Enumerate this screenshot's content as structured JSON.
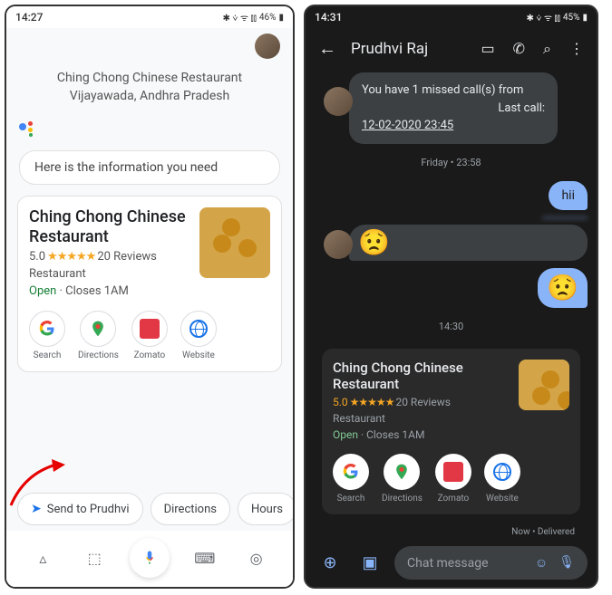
{
  "left": {
    "status": {
      "time": "14:27",
      "battery": "46%",
      "icons": "✱ ⩒ ᯤ ⫾⫾"
    },
    "location": {
      "line1": "Ching Chong Chinese Restaurant",
      "line2": "Vijayawada, Andhra Pradesh"
    },
    "assist_bubble": "Here is the information you need",
    "card": {
      "title": "Ching Chong Chinese Restaurant",
      "rating": "5.0",
      "stars": "★★★★★",
      "reviews": "20 Reviews",
      "category": "Restaurant",
      "open": "Open",
      "close": " · Closes 1AM",
      "actions": [
        {
          "label": "Search"
        },
        {
          "label": "Directions"
        },
        {
          "label": "Zomato"
        },
        {
          "label": "Website"
        }
      ]
    },
    "chips": [
      {
        "label": "Send to Prudhvi",
        "send": true
      },
      {
        "label": "Directions"
      },
      {
        "label": "Hours"
      }
    ]
  },
  "right": {
    "status": {
      "time": "14:31",
      "battery": "45%",
      "icons": "✱ ⩒ ᯤ ⫾⫾"
    },
    "header": {
      "title": "Prudhvi Raj"
    },
    "missed": {
      "line1": "You have 1 missed call(s) from",
      "line2": "Last call:",
      "date": "12-02-2020 23:45"
    },
    "date1": "Friday • 23:58",
    "msg_hii": "hii",
    "emoji": "😟",
    "time2": "14:30",
    "card": {
      "title": "Ching Chong Chinese Restaurant",
      "rating": "5.0",
      "stars": "★★★★★",
      "reviews": "20 Reviews",
      "category": "Restaurant",
      "open": "Open",
      "close": " · Closes 1AM",
      "actions": [
        {
          "label": "Search"
        },
        {
          "label": "Directions"
        },
        {
          "label": "Zomato"
        },
        {
          "label": "Website"
        }
      ]
    },
    "delivery": "Now • Delivered",
    "compose_placeholder": "Chat message"
  }
}
